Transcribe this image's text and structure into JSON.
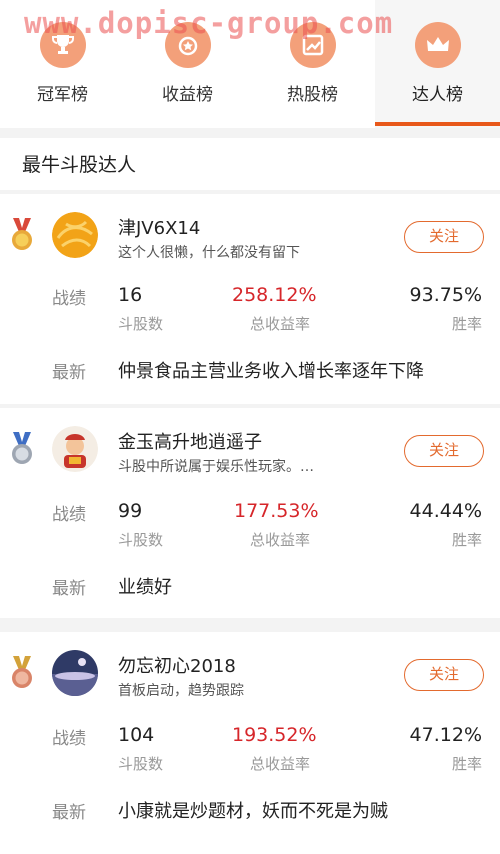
{
  "watermark": "www.dopisc-group.com",
  "tabs": [
    {
      "label": "冠军榜",
      "icon": "trophy-icon"
    },
    {
      "label": "收益榜",
      "icon": "medal-coin-icon"
    },
    {
      "label": "热股榜",
      "icon": "trend-chart-icon"
    },
    {
      "label": "达人榜",
      "icon": "crown-icon",
      "active": true
    }
  ],
  "section_title": "最牛斗股达人",
  "labels": {
    "record": "战绩",
    "latest": "最新",
    "stocks_count": "斗股数",
    "total_return": "总收益率",
    "win_rate": "胜率",
    "follow": "关注"
  },
  "users": [
    {
      "rank_medal": "gold",
      "name": "津JV6X14",
      "bio": "这个人很懒，什么都没有留下",
      "stocks": "16",
      "return": "258.12%",
      "win_rate": "93.75%",
      "latest": "仲景食品主营业务收入增长率逐年下降"
    },
    {
      "rank_medal": "silver",
      "name": "金玉高升地逍遥子",
      "bio": "斗股中所说属于娱乐性玩家。…",
      "stocks": "99",
      "return": "177.53%",
      "win_rate": "44.44%",
      "latest": "业绩好"
    },
    {
      "rank_medal": "bronze",
      "name": "勿忘初心2018",
      "bio": "首板启动，趋势跟踪",
      "stocks": "104",
      "return": "193.52%",
      "win_rate": "47.12%",
      "latest": "小康就是炒题材，妖而不死是为贼"
    }
  ],
  "colors": {
    "accent": "#e36a2e",
    "return_red": "#d6262a",
    "tab_icon": "#f3a07a"
  }
}
